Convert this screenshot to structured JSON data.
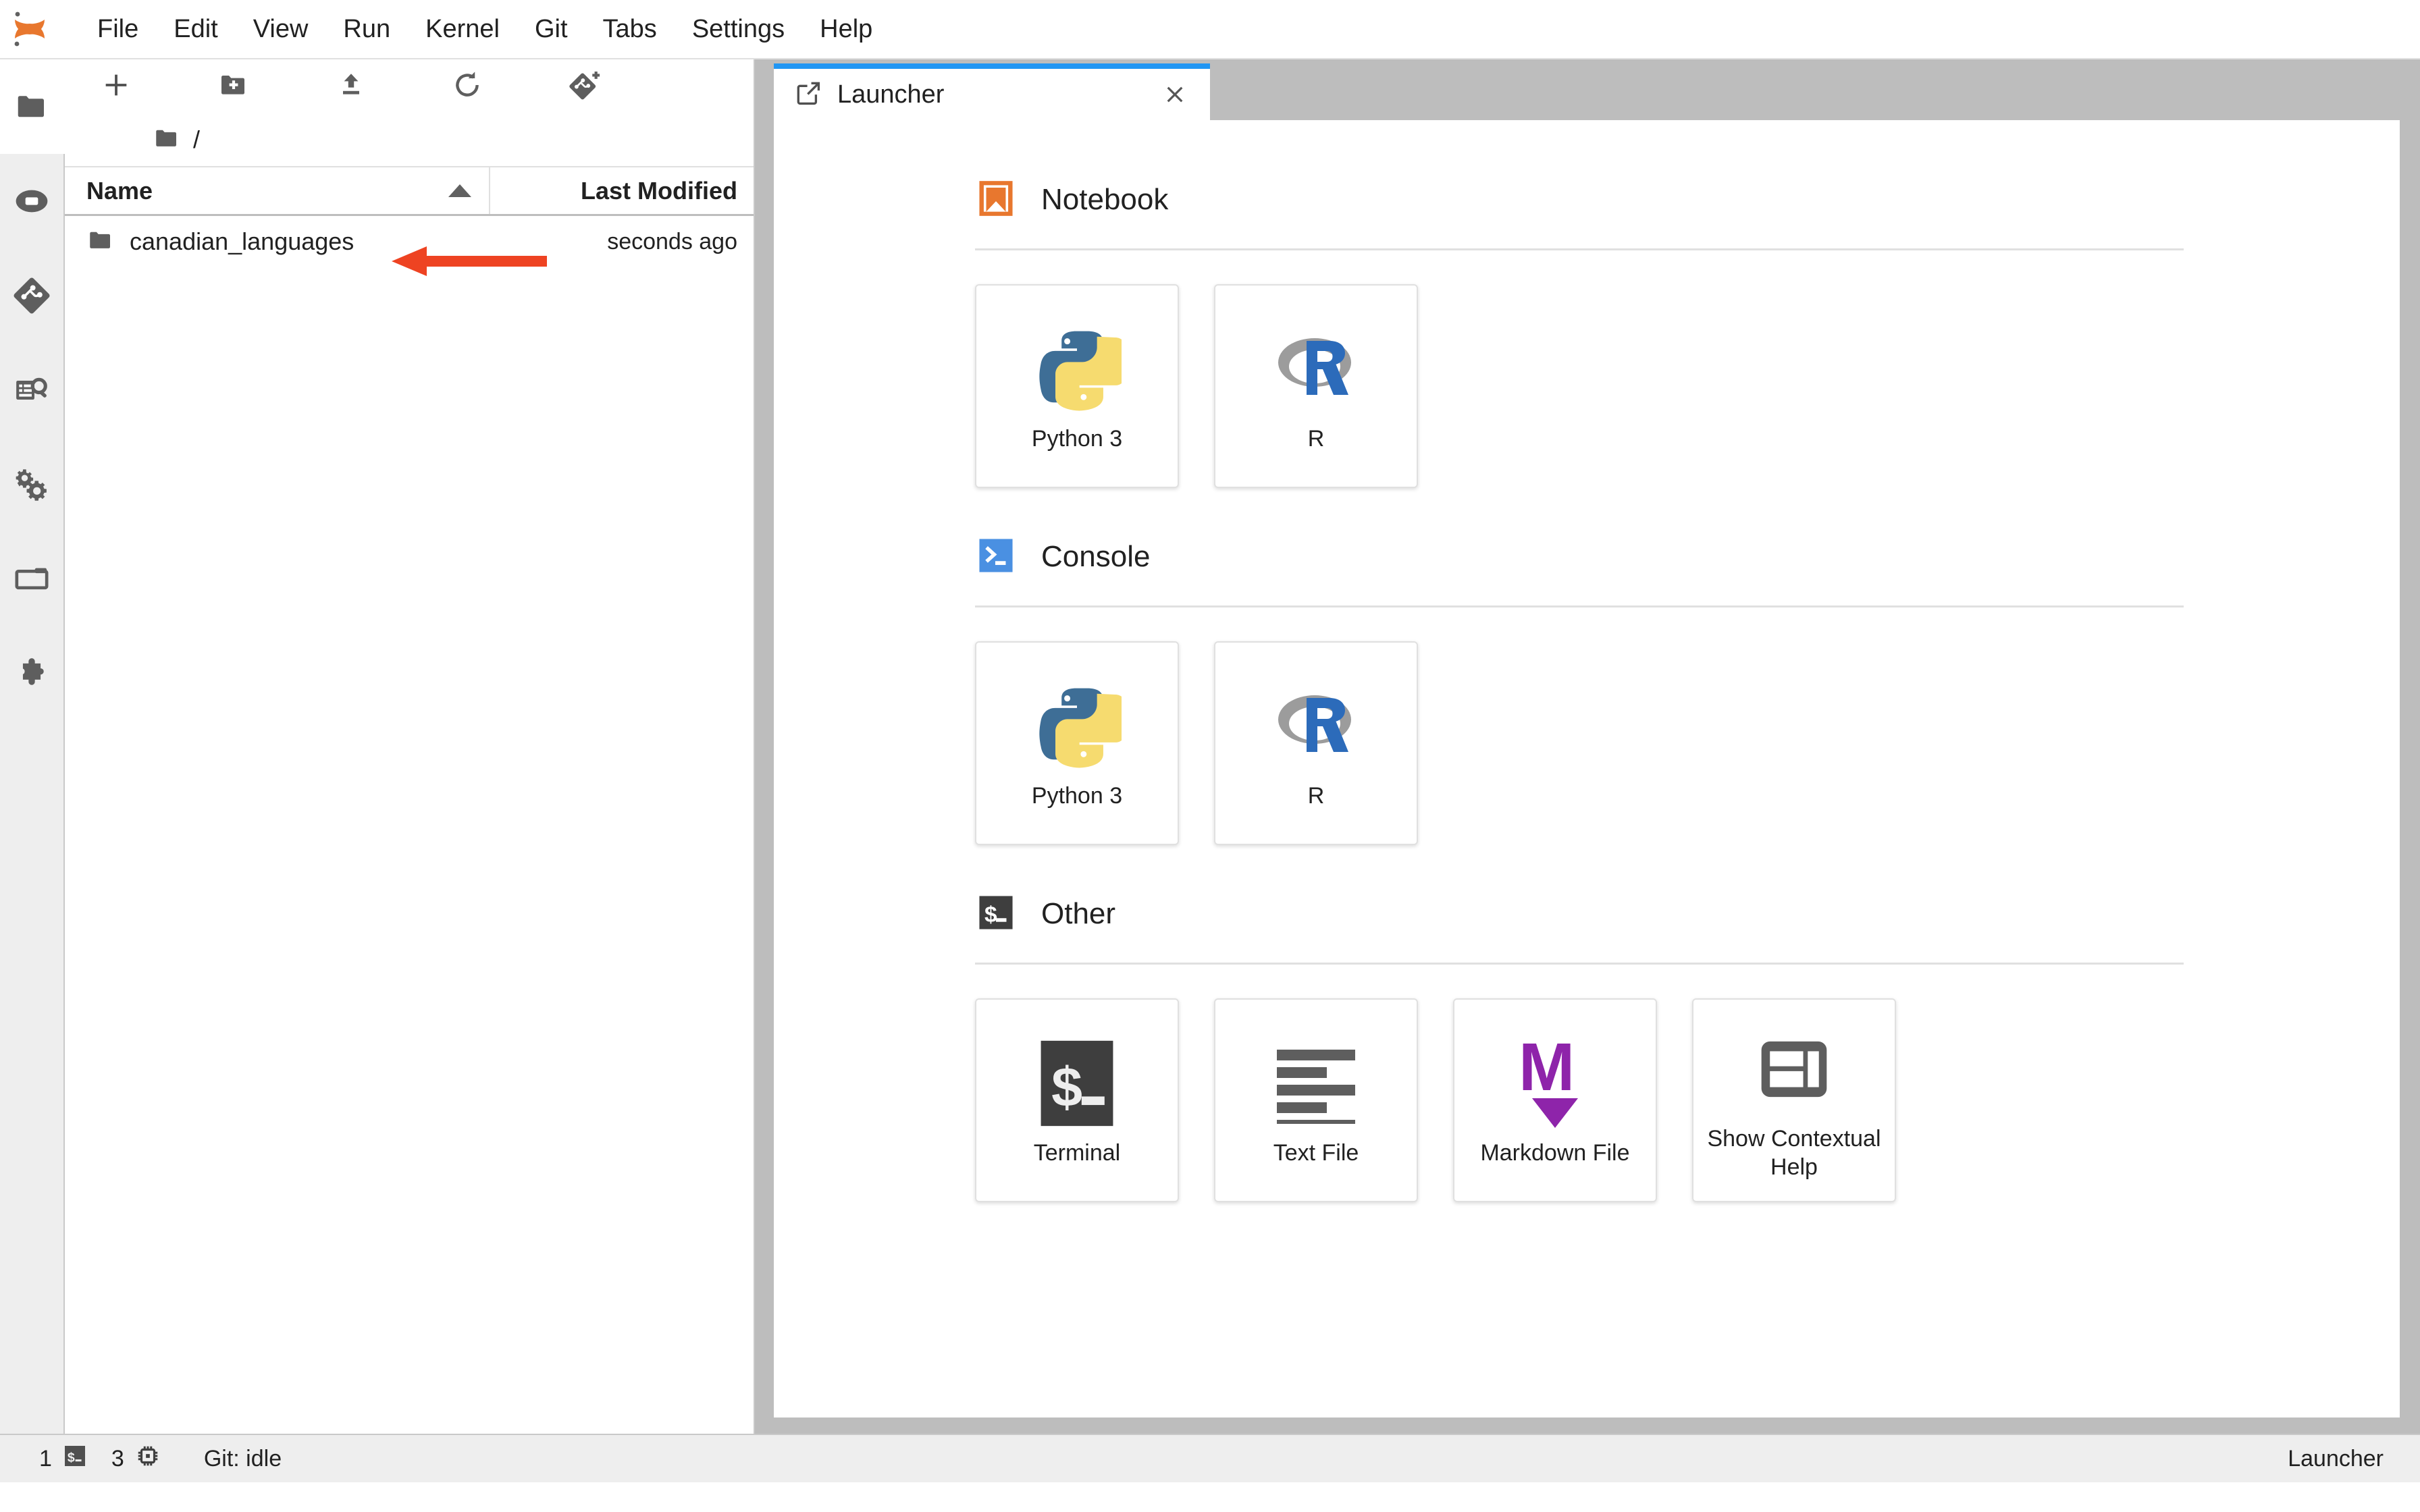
{
  "app": {
    "logo": "jupyter-logo"
  },
  "menubar": {
    "items": [
      {
        "label": "File",
        "name": "menu-file"
      },
      {
        "label": "Edit",
        "name": "menu-edit"
      },
      {
        "label": "View",
        "name": "menu-view"
      },
      {
        "label": "Run",
        "name": "menu-run"
      },
      {
        "label": "Kernel",
        "name": "menu-kernel"
      },
      {
        "label": "Git",
        "name": "menu-git"
      },
      {
        "label": "Tabs",
        "name": "menu-tabs"
      },
      {
        "label": "Settings",
        "name": "menu-settings"
      },
      {
        "label": "Help",
        "name": "menu-help"
      }
    ]
  },
  "activitybar": {
    "items": [
      {
        "icon": "folder-icon",
        "active": true
      },
      {
        "icon": "running-terminals-icon",
        "active": false
      },
      {
        "icon": "git-icon",
        "active": false
      },
      {
        "icon": "commands-icon",
        "active": false
      },
      {
        "icon": "property-inspector-icon",
        "active": false
      },
      {
        "icon": "open-tabs-icon",
        "active": false
      },
      {
        "icon": "extension-manager-icon",
        "active": false
      }
    ]
  },
  "filebrowser": {
    "toolbar": [
      {
        "icon": "new-launcher-plus-icon",
        "name": "new-launcher-button"
      },
      {
        "icon": "new-folder-icon",
        "name": "new-folder-button"
      },
      {
        "icon": "upload-icon",
        "name": "upload-files-button"
      },
      {
        "icon": "refresh-icon",
        "name": "refresh-filelist-button"
      },
      {
        "icon": "git-clone-icon",
        "name": "git-clone-button"
      }
    ],
    "breadcrumb": "/",
    "columns": {
      "name": "Name",
      "last_modified": "Last Modified",
      "sort_direction": "ascending"
    },
    "rows": [
      {
        "name": "canadian_languages",
        "type": "folder",
        "last_modified": "seconds ago",
        "annotated": true
      }
    ]
  },
  "annotation": {
    "arrow_color": "#EE4322",
    "points_to": "canadian_languages"
  },
  "dock": {
    "tabs": [
      {
        "label": "Launcher",
        "icon": "launcher-icon",
        "active": true,
        "closable": true
      }
    ]
  },
  "launcher": {
    "sections": [
      {
        "title": "Notebook",
        "icon": "notebook-icon",
        "accent": "#E8772E",
        "cards": [
          {
            "label": "Python 3",
            "icon": "python-logo"
          },
          {
            "label": "R",
            "icon": "r-logo"
          }
        ]
      },
      {
        "title": "Console",
        "icon": "console-icon",
        "accent": "#4A90E2",
        "cards": [
          {
            "label": "Python 3",
            "icon": "python-logo"
          },
          {
            "label": "R",
            "icon": "r-logo"
          }
        ]
      },
      {
        "title": "Other",
        "icon": "terminal-icon",
        "accent": "#3E3E3E",
        "cards": [
          {
            "label": "Terminal",
            "icon": "terminal-icon"
          },
          {
            "label": "Text File",
            "icon": "text-file-icon"
          },
          {
            "label": "Markdown File",
            "icon": "markdown-icon"
          },
          {
            "label": "Show Contextual Help",
            "icon": "contextual-help-icon"
          }
        ]
      }
    ]
  },
  "statusbar": {
    "terminal_count": "1",
    "terminal_icon": "terminal-icon",
    "kernel_count": "3",
    "kernel_icon": "kernel-chip-icon",
    "git_status": "Git: idle",
    "active_item": "Launcher"
  },
  "colors": {
    "jupyter_orange": "#E8772E",
    "tab_accent_blue": "#2196F3",
    "annotation_red": "#EE4322",
    "console_blue": "#4A90E2",
    "markdown_purple": "#8E24AA",
    "r_blue": "#2C6BBA",
    "python_blue": "#3E6E96",
    "python_yellow": "#F6DB6F",
    "dock_background": "#BDBDBD",
    "sidebar_background": "#EEEEEE"
  }
}
